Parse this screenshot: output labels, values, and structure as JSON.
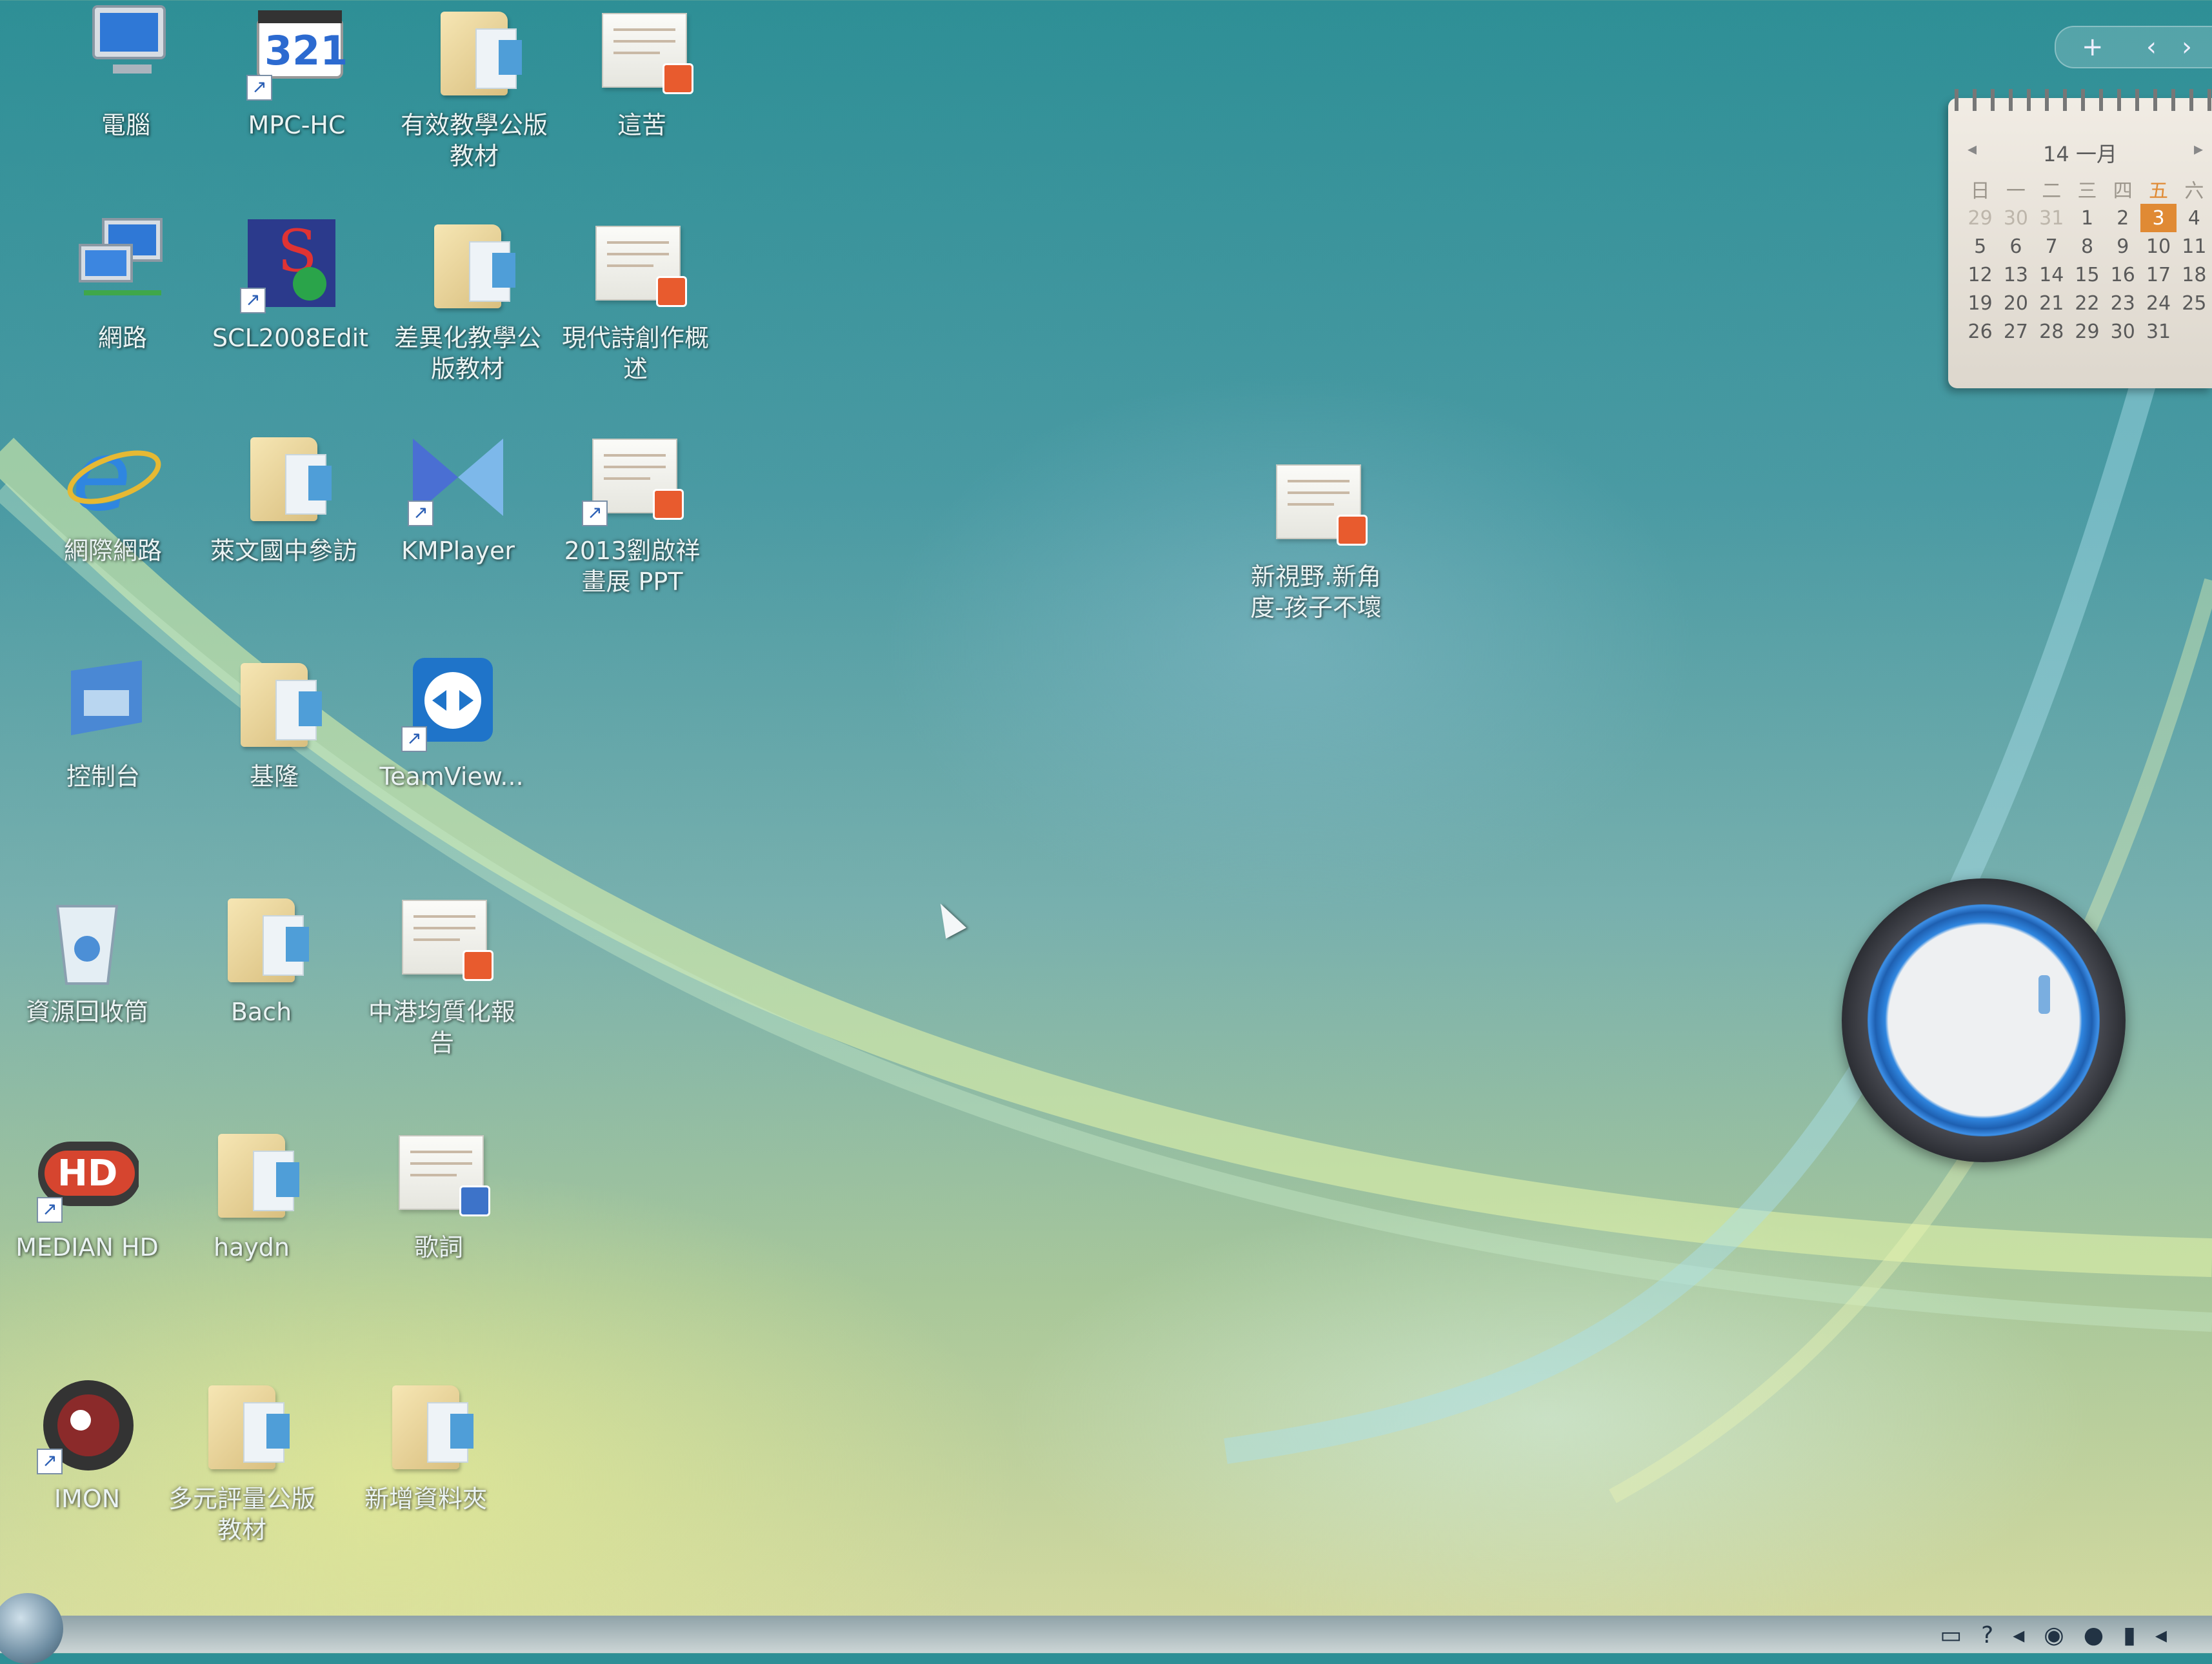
{
  "desktop": {
    "icons": [
      {
        "label": "電腦"
      },
      {
        "label": "MPC-HC"
      },
      {
        "label": "有效教學公版\n教材"
      },
      {
        "label": "這苦"
      },
      {
        "label": "網路"
      },
      {
        "label": "SCL2008Edit"
      },
      {
        "label": "差異化教學公\n版教材"
      },
      {
        "label": "現代詩創作概\n述"
      },
      {
        "label": "網際網路"
      },
      {
        "label": "萊文國中參訪"
      },
      {
        "label": "KMPlayer"
      },
      {
        "label": "2013劉啟祥\n畫展 PPT"
      },
      {
        "label": "新視野.新角\n度-孩子不壞"
      },
      {
        "label": "控制台"
      },
      {
        "label": "基隆"
      },
      {
        "label": "TeamView..."
      },
      {
        "label": "資源回收筒"
      },
      {
        "label": "Bach"
      },
      {
        "label": "中港均質化報\n告"
      },
      {
        "label": "MEDIAN HD"
      },
      {
        "label": "haydn"
      },
      {
        "label": "歌詞"
      },
      {
        "label": "IMON"
      },
      {
        "label": "多元評量公版\n教材"
      },
      {
        "label": "新增資料夾"
      }
    ]
  },
  "gadget_bar": {
    "add": "+",
    "prev": "‹",
    "next": "›"
  },
  "calendar": {
    "title": "14 一月",
    "prev": "◂",
    "next": "▸",
    "weekdays": [
      "日",
      "一",
      "二",
      "三",
      "四",
      "五",
      "六"
    ],
    "weeks": [
      [
        "29",
        "30",
        "31",
        "1",
        "2",
        "3",
        "4"
      ],
      [
        "5",
        "6",
        "7",
        "8",
        "9",
        "10",
        "11"
      ],
      [
        "12",
        "13",
        "14",
        "15",
        "16",
        "17",
        "18"
      ],
      [
        "19",
        "20",
        "21",
        "22",
        "23",
        "24",
        "25"
      ],
      [
        "26",
        "27",
        "28",
        "29",
        "30",
        "31",
        ""
      ]
    ],
    "today": "3"
  },
  "colors": {
    "accent": "#e08a34",
    "clock_ring": "#2f86e0"
  }
}
